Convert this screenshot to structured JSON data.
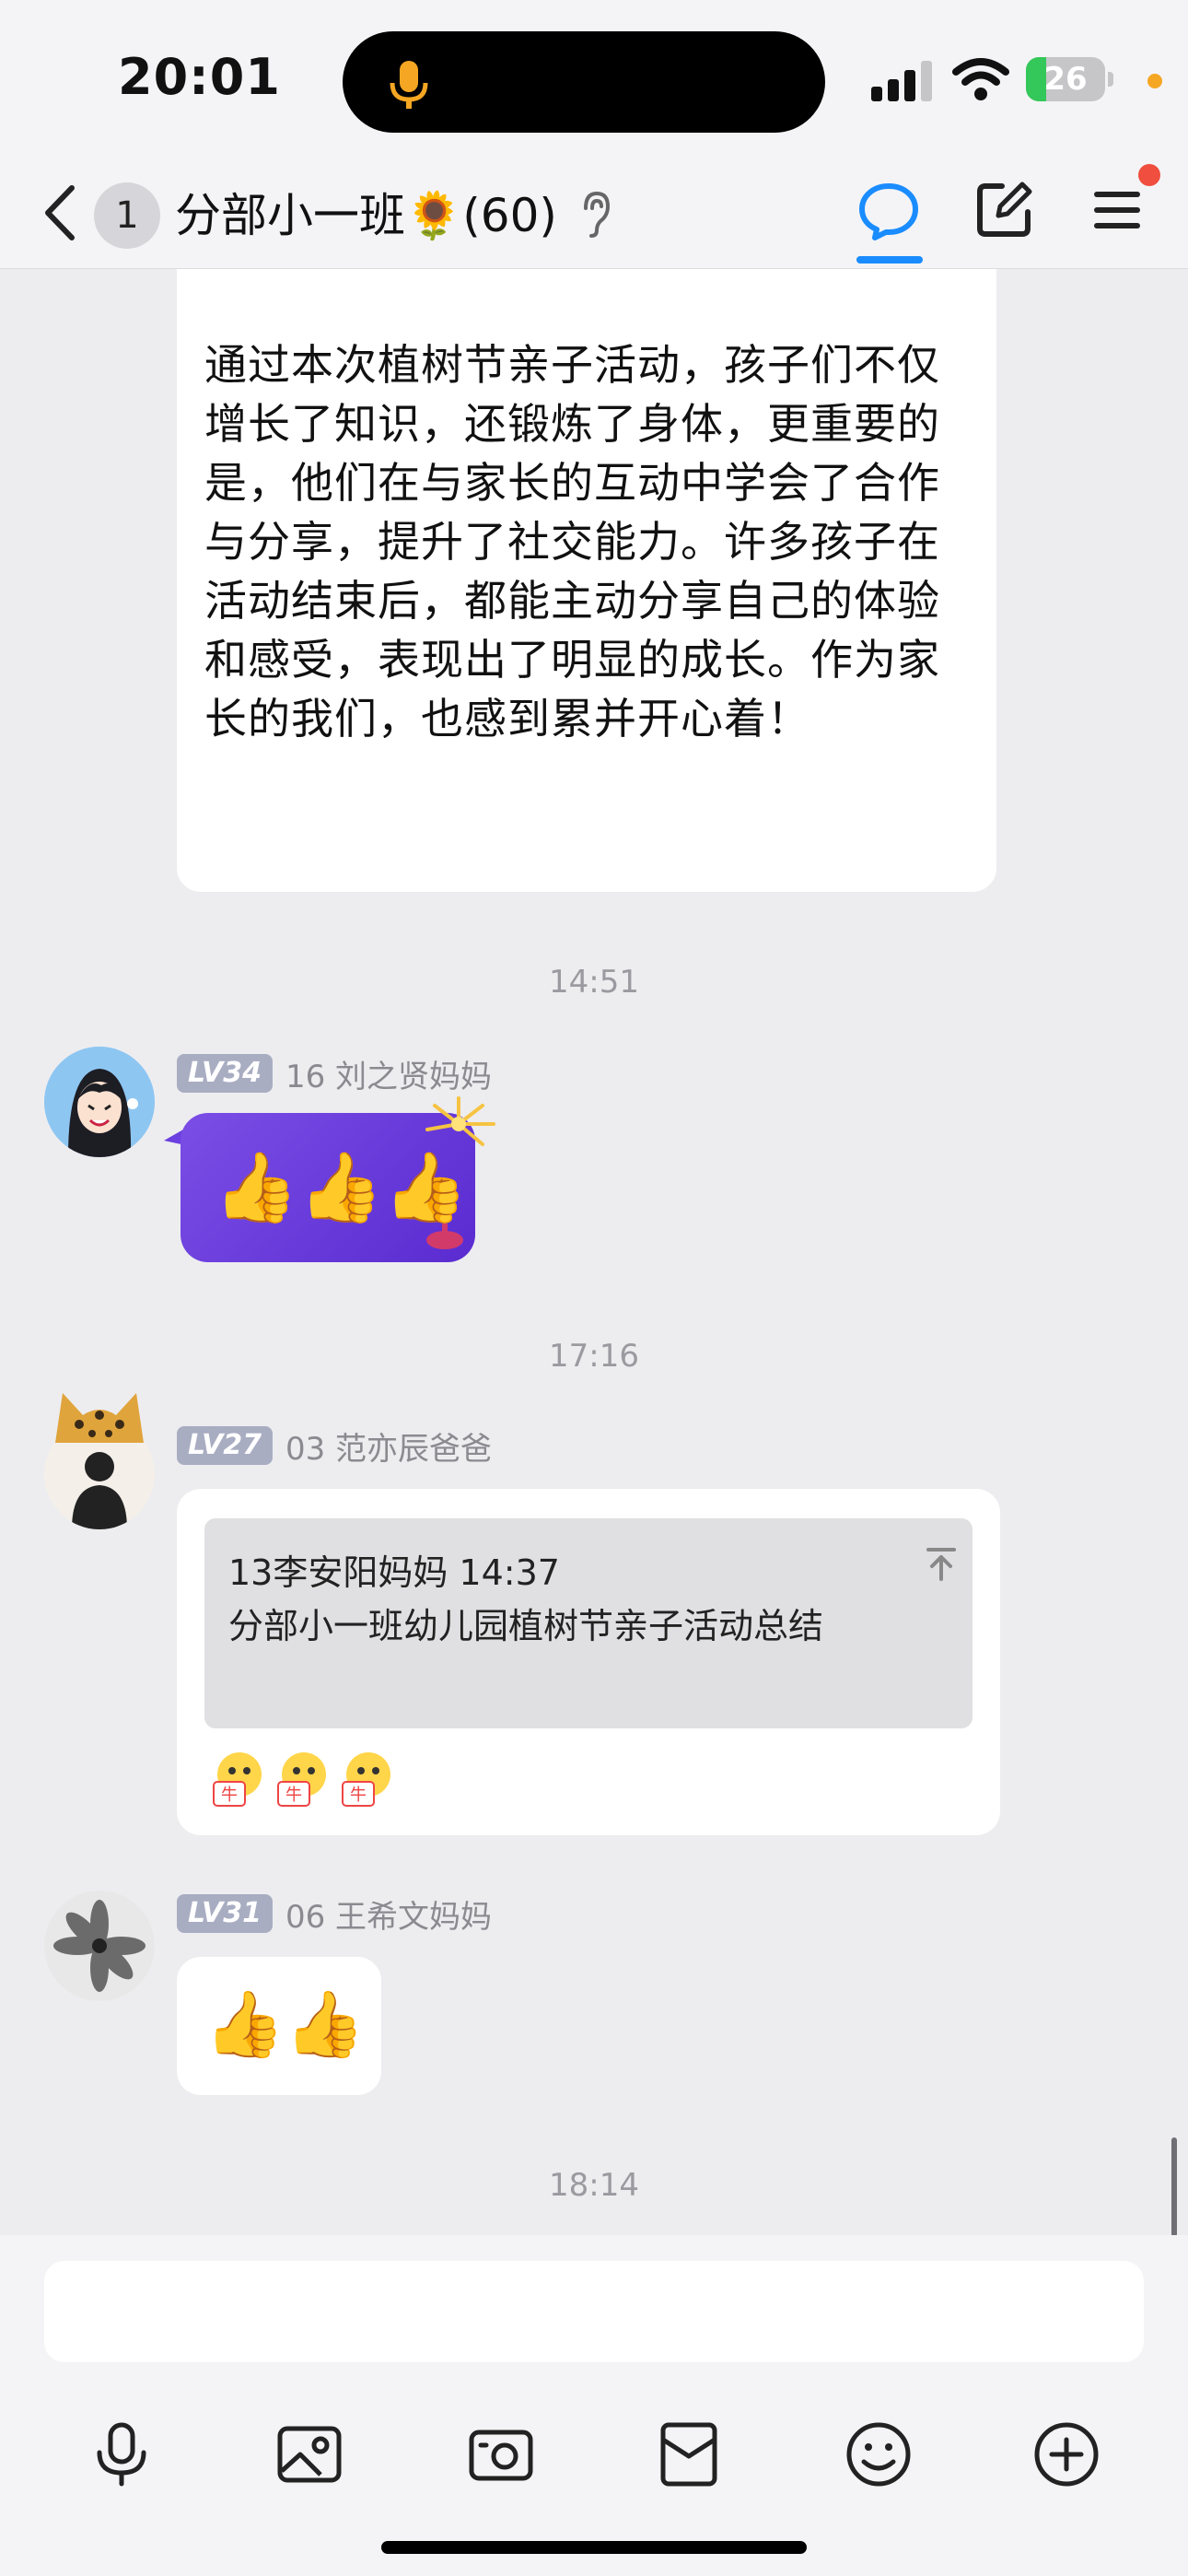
{
  "status_bar": {
    "time": "20:01",
    "battery_level": "26",
    "battery_fraction": 0.26,
    "colors": {
      "battery_fill": "#34c759",
      "mic": "#f5a623",
      "private_dot": "#f5a623"
    }
  },
  "header": {
    "unread_count": "1",
    "group_title": "分部小一班🌻(60)",
    "accent_color": "#1a8cff",
    "notification_dot_color": "#f04e3e"
  },
  "messages": {
    "long_text": "通过本次植树节亲子活动，孩子们不仅增长了知识，还锻炼了身体，更重要的是，他们在与家长的互动中学会了合作与分享，提升了社交能力。许多孩子在活动结束后，都能主动分享自己的体验和感受，表现出了明显的成长。作为家长的我们，也感到累并开心着！",
    "ts1": "14:51",
    "msg2": {
      "level": "LV34",
      "sender": "16 刘之贤妈妈",
      "thumbs": "👍👍👍"
    },
    "ts2": "17:16",
    "msg3": {
      "level": "LV27",
      "sender": "03 范亦辰爸爸",
      "quote_meta": "13李安阳妈妈 14:37",
      "quote_title": "分部小一班幼儿园植树节亲子活动总结"
    },
    "msg4": {
      "level": "LV31",
      "sender": "06 王希文妈妈",
      "thumbs": "👍👍"
    },
    "ts3": "18:14"
  },
  "input": {
    "placeholder": ""
  },
  "icons": {
    "toolbar": [
      "microphone-icon",
      "photo-icon",
      "camera-icon",
      "red-packet-icon",
      "emoji-icon",
      "plus-icon"
    ]
  }
}
